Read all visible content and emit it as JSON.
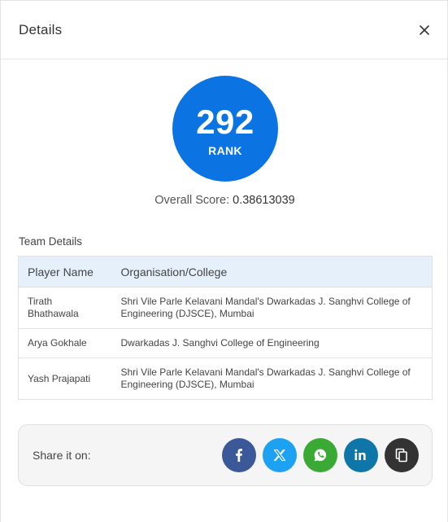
{
  "modal": {
    "title": "Details"
  },
  "rank": {
    "number": "292",
    "label": "RANK"
  },
  "score": {
    "label": "Overall Score:",
    "value": "0.38613039"
  },
  "team": {
    "section_title": "Team Details",
    "columns": [
      "Player Name",
      "Organisation/College"
    ],
    "rows": [
      {
        "name": "Tirath Bhathawala",
        "org": "Shri Vile Parle Kelavani Mandal's Dwarkadas J. Sanghvi College of Engineering (DJSCE), Mumbai"
      },
      {
        "name": "Arya Gokhale",
        "org": "Dwarkadas J. Sanghvi College of Engineering"
      },
      {
        "name": "Yash Prajapati",
        "org": "Shri Vile Parle Kelavani Mandal's Dwarkadas J. Sanghvi College of Engineering (DJSCE), Mumbai"
      }
    ]
  },
  "share": {
    "label": "Share it on:",
    "buttons": [
      {
        "icon": "facebook-icon",
        "color": "#3b5998"
      },
      {
        "icon": "x-twitter-icon",
        "color": "#1da1f2"
      },
      {
        "icon": "whatsapp-icon",
        "color": "#3aaa35"
      },
      {
        "icon": "linkedin-icon",
        "color": "#0e76a8"
      },
      {
        "icon": "copy-icon",
        "color": "#333333"
      }
    ]
  },
  "colors": {
    "rank_circle": "#0c74e2",
    "table_header_bg": "#e5f0fb",
    "share_box_bg": "#f5f5f5"
  }
}
